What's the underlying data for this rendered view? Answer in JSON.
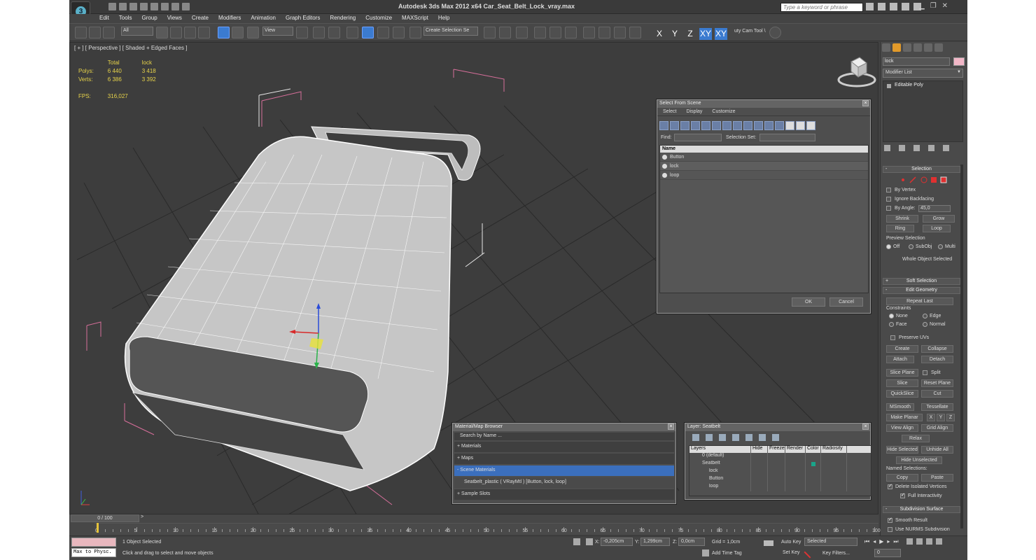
{
  "app": {
    "title": "Autodesk 3ds Max  2012 x64     Car_Seat_Belt_Lock_vray.max",
    "search_placeholder": "Type a keyword or phrase"
  },
  "menu": [
    "Edit",
    "Tools",
    "Group",
    "Views",
    "Create",
    "Modifiers",
    "Animation",
    "Graph Editors",
    "Rendering",
    "Customize",
    "MAXScript",
    "Help"
  ],
  "toolbar": {
    "filter_value": "All",
    "refcoord_value": "View",
    "selection_set_placeholder": "Create Selection Se",
    "axis_x": "X",
    "axis_y": "Y",
    "axis_z": "Z",
    "axis_xy": "XY",
    "axis_xy2": "XY",
    "camtool_label": "uty Cam Tool \\"
  },
  "viewport": {
    "label": "[ + ] [ Perspective ] [ Shaded + Edged Faces ]",
    "stats": {
      "col_total": "Total",
      "col_lock": "lock",
      "polys_label": "Polys:",
      "polys_total": "6 440",
      "polys_lock": "3 418",
      "verts_label": "Verts:",
      "verts_total": "6 386",
      "verts_lock": "3 392",
      "fps_label": "FPS:",
      "fps_value": "316,027"
    }
  },
  "select_dialog": {
    "title": "Select From Scene",
    "menu": [
      "Select",
      "Display",
      "Customize"
    ],
    "find_label": "Find:",
    "selection_set_label": "Selection Set:",
    "column_name": "Name",
    "items": [
      "Button",
      "lock",
      "loop"
    ],
    "ok": "OK",
    "cancel": "Cancel"
  },
  "material_browser": {
    "title": "Material/Map Browser",
    "search": "Search by Name ...",
    "materials": "+ Materials",
    "maps": "+ Maps",
    "scene_materials": "- Scene Materials",
    "material_item": "Seatbelt_plastic  ( VRayMtl )  [Button, lock, loop]",
    "sample_slots": "+ Sample Slots"
  },
  "layer_dialog": {
    "title": "Layer: Seatbelt",
    "headers": [
      "Layers",
      "Hide",
      "Freeze",
      "Render",
      "Color",
      "Radiosity"
    ],
    "rows": [
      "0 (default)",
      "Seatbelt",
      "lock",
      "Button",
      "loop"
    ]
  },
  "command_panel": {
    "object_name": "lock",
    "modifier_list": "Modifier List",
    "stack_item": "Editable Poly",
    "selection_header": "Selection",
    "by_vertex": "By Vertex",
    "ignore_backfacing": "Ignore Backfacing",
    "by_angle": "By Angle:",
    "angle_value": "45,0",
    "shrink": "Shrink",
    "grow": "Grow",
    "ring": "Ring",
    "loop": "Loop",
    "preview_selection": "Preview Selection",
    "off": "Off",
    "subobj": "SubObj",
    "multi": "Multi",
    "whole_object": "Whole Object Selected",
    "soft_selection": "Soft Selection",
    "edit_geometry": "Edit Geometry",
    "repeat_last": "Repeat Last",
    "constraints": "Constraints",
    "none": "None",
    "edge": "Edge",
    "face": "Face",
    "normal": "Normal",
    "preserve_uvs": "Preserve UVs",
    "create": "Create",
    "collapse": "Collapse",
    "attach": "Attach",
    "detach": "Detach",
    "slice_plane": "Slice Plane",
    "split": "Split",
    "slice": "Slice",
    "reset_plane": "Reset Plane",
    "quickslice": "QuickSlice",
    "cut": "Cut",
    "msmooth": "MSmooth",
    "tessellate": "Tessellate",
    "make_planar": "Make Planar",
    "x": "X",
    "y": "Y",
    "z": "Z",
    "view_align": "View Align",
    "grid_align": "Grid Align",
    "relax": "Relax",
    "hide_selected": "Hide Selected",
    "unhide_all": "Unhide All",
    "hide_unselected": "Hide Unselected",
    "named_selections": "Named Selections:",
    "copy": "Copy",
    "paste": "Paste",
    "delete_isolated": "Delete Isolated Vertices",
    "full_interactivity": "Full Interactivity",
    "subdivision_surface": "Subdivision Surface",
    "smooth_result": "Smooth Result",
    "use_nurms": "Use NURMS Subdivision"
  },
  "timeline": {
    "slider": "0 / 100",
    "ticks": [
      "0",
      "5",
      "10",
      "15",
      "20",
      "25",
      "30",
      "35",
      "40",
      "45",
      "50",
      "55",
      "60",
      "65",
      "70",
      "75",
      "80",
      "85",
      "90",
      "95",
      "100"
    ]
  },
  "status": {
    "script": "Max to Physc.",
    "selected": "1 Object Selected",
    "prompt": "Click and drag to select and move objects",
    "x_label": "X:",
    "x_value": "-0,205cm",
    "y_label": "Y:",
    "y_value": "1,299cm",
    "z_label": "Z:",
    "z_value": "0,0cm",
    "grid": "Grid = 1,0cm",
    "add_time_tag": "Add Time Tag",
    "auto_key": "Auto Key",
    "set_key": "Set Key",
    "selected_dropdown": "Selected",
    "key_filters": "Key Filters...",
    "frame": "0"
  }
}
